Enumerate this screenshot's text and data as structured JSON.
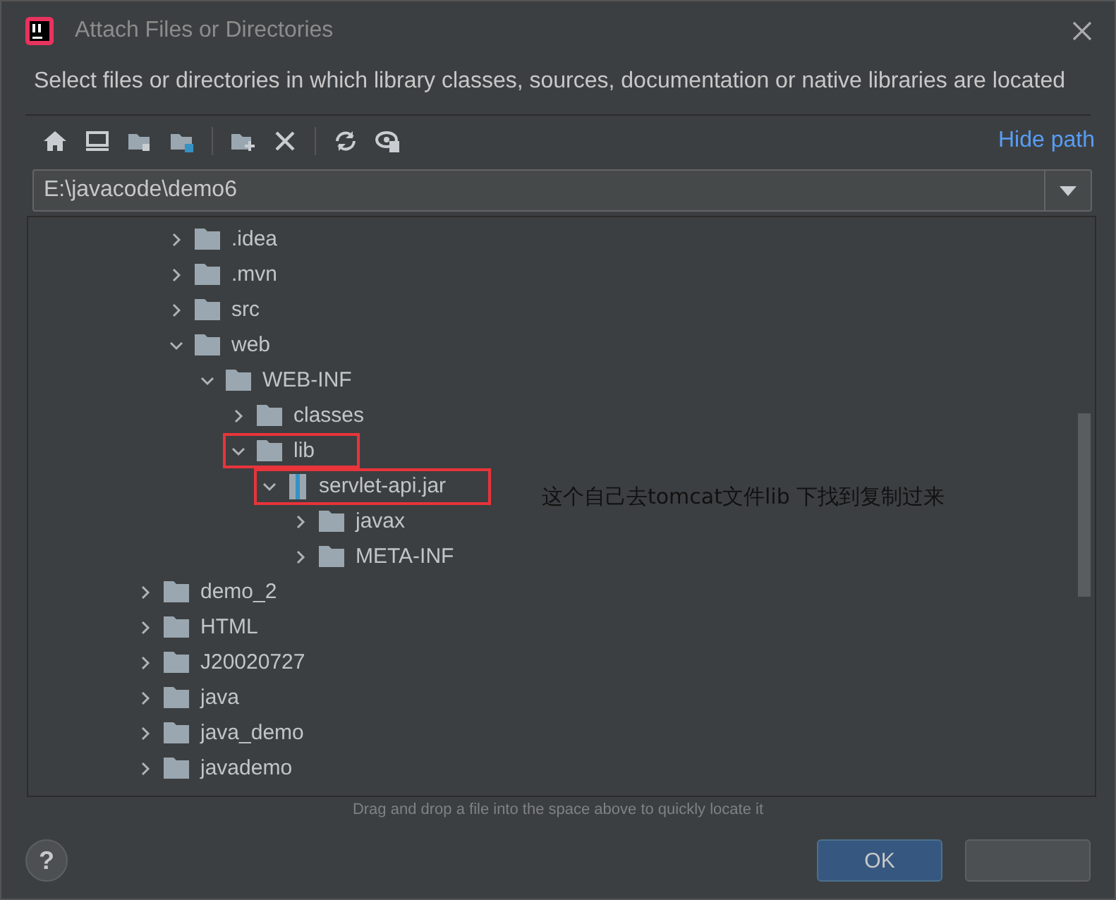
{
  "window": {
    "title": "Attach Files or Directories"
  },
  "description": "Select files or directories in which library classes, sources, documentation or native libraries are located",
  "toolbar": {
    "buttons": [
      {
        "kind": "home"
      },
      {
        "kind": "desktop"
      },
      {
        "kind": "project"
      },
      {
        "kind": "module"
      },
      {
        "kind": "separator"
      },
      {
        "kind": "new-folder"
      },
      {
        "kind": "delete"
      },
      {
        "kind": "separator"
      },
      {
        "kind": "refresh"
      },
      {
        "kind": "show-hidden"
      }
    ],
    "link": "Hide path"
  },
  "path_field": {
    "value": "E:\\javacode\\demo6"
  },
  "tree": {
    "nested_items": [
      {
        "label": ".idea",
        "kind": "folder",
        "expanded": false,
        "highlighted": false
      },
      {
        "label": ".mvn",
        "kind": "folder",
        "expanded": false,
        "highlighted": false
      },
      {
        "label": "src",
        "kind": "folder",
        "expanded": false,
        "highlighted": false
      },
      {
        "label": "web",
        "kind": "folder",
        "expanded": true,
        "highlighted": false,
        "children": [
          {
            "label": "WEB-INF",
            "kind": "folder",
            "expanded": true,
            "highlighted": false,
            "children": [
              {
                "label": "classes",
                "kind": "folder",
                "expanded": false,
                "highlighted": false
              },
              {
                "label": "lib",
                "kind": "folder",
                "expanded": true,
                "highlighted": true,
                "children": [
                  {
                    "label": "servlet-api.jar",
                    "kind": "jar",
                    "expanded": true,
                    "highlighted": true,
                    "children": [
                      {
                        "label": "javax",
                        "kind": "folder",
                        "expanded": false,
                        "highlighted": false
                      },
                      {
                        "label": "META-INF",
                        "kind": "folder",
                        "expanded": false,
                        "highlighted": false
                      }
                    ]
                  }
                ]
              }
            ]
          }
        ]
      }
    ],
    "items": [
      {
        "label": "demo_2",
        "kind": "folder",
        "expanded": false,
        "highlighted": false
      },
      {
        "label": "HTML",
        "kind": "folder",
        "expanded": false,
        "highlighted": false
      },
      {
        "label": "J20020727",
        "kind": "folder",
        "expanded": false,
        "highlighted": false
      },
      {
        "label": "java",
        "kind": "folder",
        "expanded": false,
        "highlighted": false
      },
      {
        "label": "java_demo",
        "kind": "folder",
        "expanded": false,
        "highlighted": false
      },
      {
        "label": "javademo",
        "kind": "folder",
        "expanded": false,
        "highlighted": false
      }
    ]
  },
  "annotation": "这个自己去tomcat文件lib 下找到复制过来",
  "drop_hint": "Drag and drop a file into the space above to quickly locate it",
  "help_button": "?",
  "buttons": [
    {
      "label": "OK",
      "kind": "primary"
    },
    {
      "kind": "secondary"
    }
  ]
}
